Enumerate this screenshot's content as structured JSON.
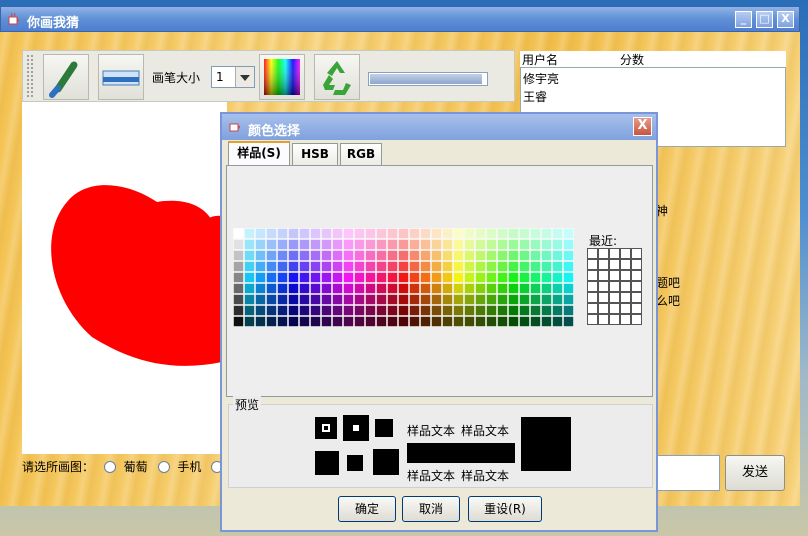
{
  "app": {
    "title": "你画我猜",
    "window_buttons": [
      "_",
      "□",
      "X"
    ]
  },
  "toolbar": {
    "brush_icon": "paintbrush-icon",
    "eraser_icon": "eraser-icon",
    "brush_size_label": "画笔大小",
    "brush_size_value": "1",
    "color_icon": "color-palette-icon",
    "clear_icon": "recycle-icon",
    "progress": 0.95
  },
  "drawing": {
    "shape_color": "#ff0000"
  },
  "picture_choice": {
    "label": "请选所画图：",
    "options": [
      "葡萄",
      "手机"
    ]
  },
  "scoreboard": {
    "headers": [
      "用户名",
      "分数"
    ],
    "users": [
      "修宇亮",
      "王睿"
    ]
  },
  "chat": {
    "visible_fragments": [
      "神",
      "题吧",
      "么吧"
    ],
    "send_label": "发送"
  },
  "dialog": {
    "title": "颜色选择",
    "close": "X",
    "tabs": [
      "样品(S)",
      "HSB",
      "RGB"
    ],
    "active_tab": 0,
    "recent_label": "最近:",
    "preview_label": "预览",
    "sample_text": "样品文本",
    "buttons": {
      "ok": "确定",
      "cancel": "取消",
      "reset": "重设(R)"
    }
  },
  "colors": {
    "accent_title": "#5f8fd6",
    "dialog_bg": "#ece9d8",
    "wood": "#f4c455"
  }
}
